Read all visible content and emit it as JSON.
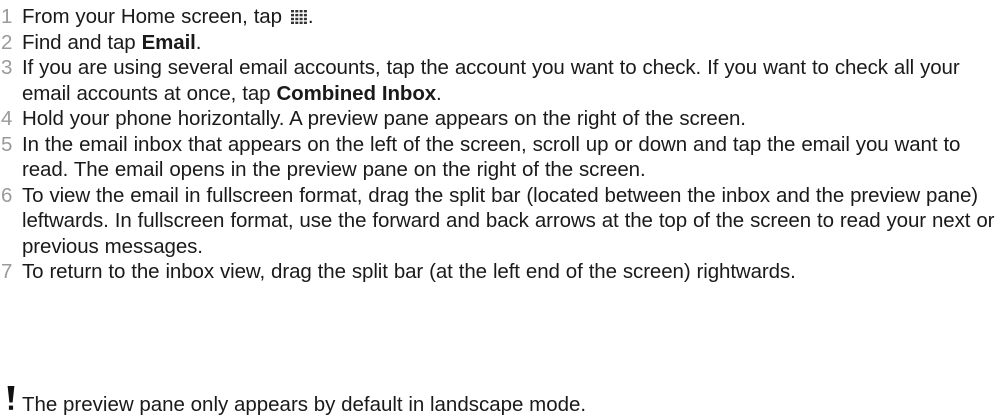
{
  "steps": [
    {
      "number": "1",
      "before": "From your Home screen, tap ",
      "icon": "app-grid-icon",
      "after": "."
    },
    {
      "number": "2",
      "before": "Find and tap ",
      "bold": "Email",
      "after": "."
    },
    {
      "number": "3",
      "before": "If you are using several email accounts, tap the account you want to check. If you want to check all your email accounts at once, tap ",
      "bold": "Combined Inbox",
      "after": "."
    },
    {
      "number": "4",
      "text": "Hold your phone horizontally. A preview pane appears on the right of the screen."
    },
    {
      "number": "5",
      "text": "In the email inbox that appears on the left of the screen, scroll up or down and tap the email you want to read. The email opens in the preview pane on the right of the screen."
    },
    {
      "number": "6",
      "text": "To view the email in fullscreen format, drag the split bar (located between the inbox and the preview pane) leftwards. In fullscreen format, use the forward and back arrows at the top of the screen to read your next or previous messages."
    },
    {
      "number": "7",
      "text": "To return to the inbox view, drag the split bar (at the left end of the screen) rightwards."
    }
  ],
  "note": {
    "icon": "exclamation-icon",
    "text": "The preview pane only appears by default in landscape mode."
  }
}
